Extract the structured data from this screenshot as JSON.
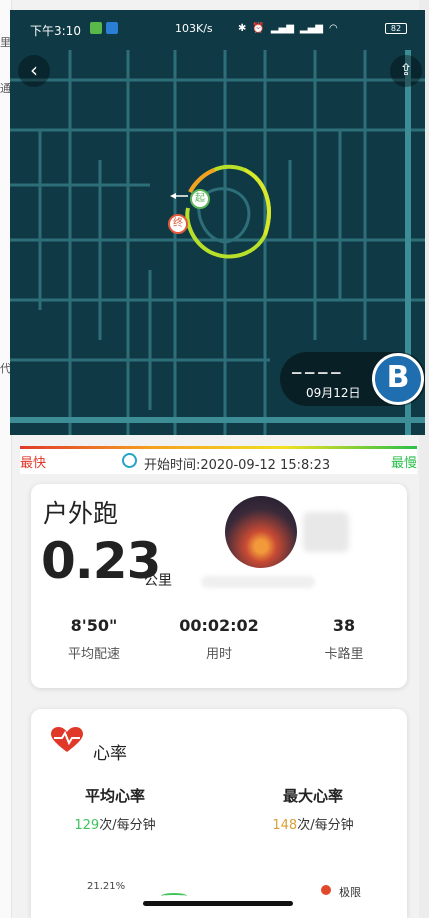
{
  "status_bar": {
    "time": "下午3:10",
    "network_speed": "103K/s",
    "battery": "82"
  },
  "map": {
    "start_marker": "起",
    "end_marker": "终",
    "user_date": "09月12日",
    "logo_letter": "B"
  },
  "pace_legend": {
    "fast_label": "最快",
    "slow_label": "最慢",
    "start_time": "开始时间:2020-09-12 15:8:23"
  },
  "summary": {
    "sport_type": "户外跑",
    "distance": "0.23",
    "distance_unit": "公里",
    "stats": [
      {
        "value": "8'50\"",
        "label": "平均配速"
      },
      {
        "value": "00:02:02",
        "label": "用时"
      },
      {
        "value": "38",
        "label": "卡路里"
      }
    ]
  },
  "heart_rate": {
    "title": "心率",
    "avg_label": "平均心率",
    "avg_value": "129",
    "max_label": "最大心率",
    "max_value": "148",
    "unit": "次/每分钟",
    "chart_percent": "21.21%",
    "zone_label": "极限"
  },
  "colors": {
    "map_bg": "#0f3a45",
    "fast": "#e0392a",
    "slow": "#2bbf4a",
    "avg_hr": "#3ec45a",
    "max_hr": "#d9a03a"
  }
}
